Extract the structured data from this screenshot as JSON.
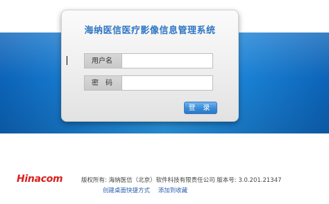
{
  "system_title": "海纳医信医疗影像信息管理系统",
  "form": {
    "username_label": "用户名",
    "username_value": "",
    "password_label": "密　码",
    "password_value": "",
    "login_button": "登 录"
  },
  "footer": {
    "logo_text": "Hinacom",
    "copyright": "版权所有: 海纳医信（北京）软件科技有限责任公司 版本号: 3.0.201.21347",
    "links": [
      "创建桌面快捷方式",
      "添加到收藏"
    ]
  },
  "colors": {
    "accent_blue": "#2f76c4",
    "banner_blue": "#1d86d9",
    "logo_red": "#d8211d"
  }
}
